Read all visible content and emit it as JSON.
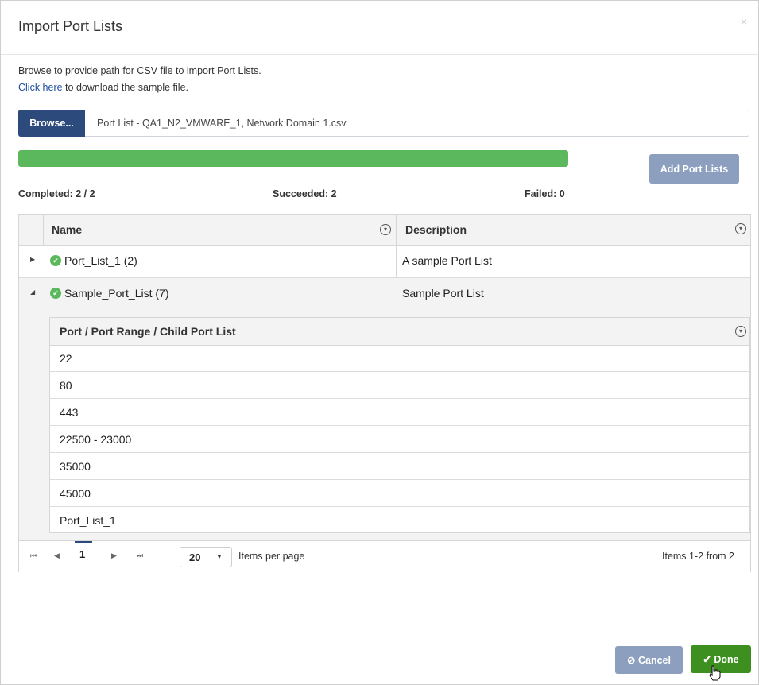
{
  "dialog": {
    "title": "Import Port Lists",
    "close_icon": "×",
    "intro_line1": "Browse to provide path for CSV file to import Port Lists.",
    "intro_link": "Click here",
    "intro_line2_rest": " to download the sample file."
  },
  "file_picker": {
    "browse_label": "Browse...",
    "file_name": "Port List - QA1_N2_VMWARE_1, Network Domain 1.csv"
  },
  "progress": {
    "fraction": 1.0,
    "color": "#5cb85c"
  },
  "add_button_label": "Add Port Lists",
  "stats": {
    "completed": "Completed: 2 / 2",
    "succeeded": "Succeeded: 2",
    "failed": "Failed: 0"
  },
  "grid": {
    "columns": [
      "Name",
      "Description"
    ],
    "rows": [
      {
        "name": "Port_List_1 (2)",
        "description": "A sample Port List",
        "expanded": false
      },
      {
        "name": "Sample_Port_List (7)",
        "description": "Sample Port List",
        "expanded": true
      }
    ],
    "expand_icon": "▶",
    "collapse_icon": "◢",
    "status_icon": "✔",
    "filter_icon": "▾"
  },
  "child_grid": {
    "column": "Port / Port Range / Child Port List",
    "rows": [
      "22",
      "80",
      "443",
      "22500 - 23000",
      "35000",
      "45000",
      "Port_List_1"
    ]
  },
  "pager": {
    "first_icon": "⏮",
    "prev_icon": "◀",
    "current_page": "1",
    "next_icon": "▶",
    "last_icon": "⏭",
    "page_size": "20",
    "caret_icon": "▼",
    "items_per_page_label": "Items per page",
    "info": "Items 1-2 from 2"
  },
  "footer": {
    "cancel_icon": "⊘",
    "cancel_label": "Cancel",
    "done_icon": "✔",
    "done_label": "Done"
  },
  "colors": {
    "primary": "#2d4a7c",
    "muted_button": "#8c9fbe",
    "success": "#3d8f1f"
  }
}
